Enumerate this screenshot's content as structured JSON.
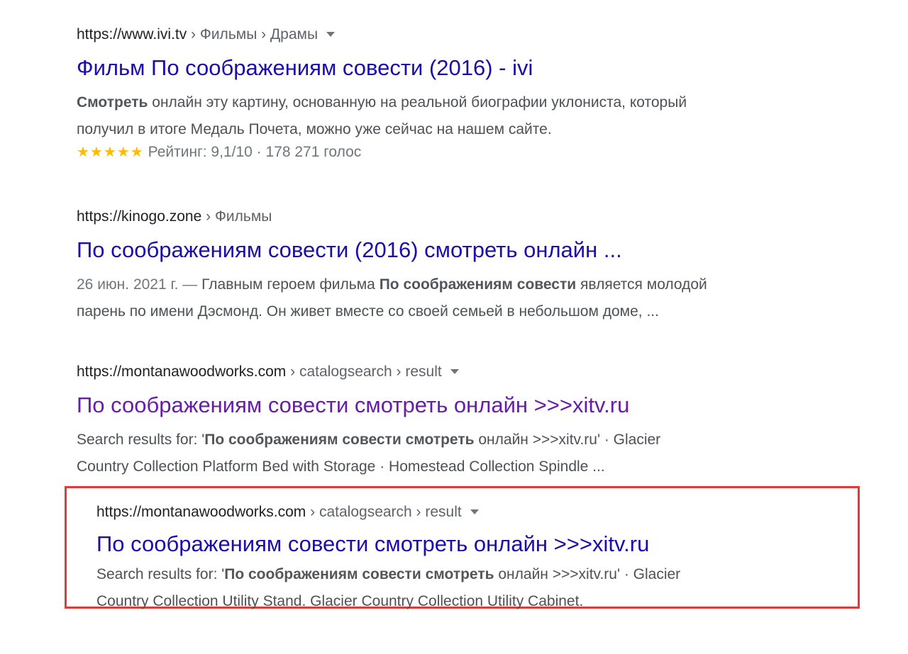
{
  "results": [
    {
      "url": "https://www.ivi.tv",
      "breadcrumbs": " › Фильмы › Драмы",
      "has_menu": true,
      "title": "Фильм По соображениям совести (2016) - ivi",
      "snippet_line1_bold": "Смотреть",
      "snippet_line1_rest": " онлайн эту картину, основанную на реальной биографии уклониста, который",
      "snippet_line2": "получил в итоге Медаль Почета, можно уже сейчас на нашем сайте.",
      "rating_stars": "★★★★★",
      "rating_text": "Рейтинг: 9,1/10 · 178 271 голос"
    },
    {
      "url": "https://kinogo.zone",
      "breadcrumbs": " › Фильмы",
      "title": "По соображениям совести (2016) смотреть онлайн ...",
      "date": "26 июн. 2021 г. — ",
      "snippet_line1_a": "Главным героем фильма ",
      "snippet_line1_bold": "По соображениям совести",
      "snippet_line1_b": " является молодой",
      "snippet_line2": "парень по имени Дэсмонд. Он живет вместе со своей семьей в небольшом доме, ..."
    },
    {
      "url": "https://montanawoodworks.com",
      "breadcrumbs": " › catalogsearch › result",
      "has_menu": true,
      "title": "По соображениям совести смотреть онлайн >>>xitv.ru",
      "visited": true,
      "snippet_prefix": "Search results for: '",
      "snippet_bold": "По соображениям совести смотреть",
      "snippet_rest": " онлайн >>>xitv.ru' · Glacier",
      "snippet_line2": "Country Collection Platform Bed with Storage · Homestead Collection Spindle ..."
    },
    {
      "url": "https://montanawoodworks.com",
      "breadcrumbs": " › catalogsearch › result",
      "has_menu": true,
      "title": "По соображениям совести смотреть онлайн >>>xitv.ru",
      "snippet_prefix": "Search results for: '",
      "snippet_bold": "По соображениям совести смотреть",
      "snippet_rest": " онлайн >>>xitv.ru' · Glacier",
      "snippet_line2": "Country Collection Utility Stand. Glacier Country Collection Utility Cabinet.",
      "highlighted": true
    }
  ],
  "colors": {
    "link": "#1a0dab",
    "visited_link": "#681da8",
    "highlight_border": "#e53935",
    "star": "#fbbc04"
  }
}
